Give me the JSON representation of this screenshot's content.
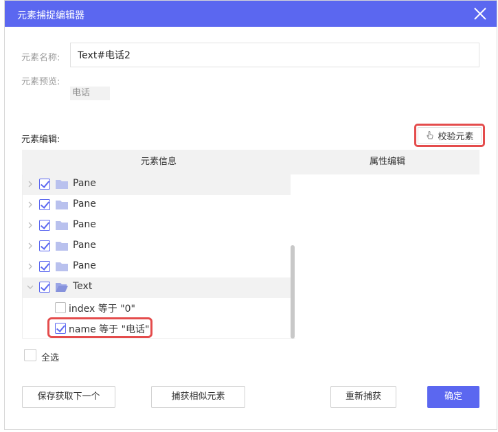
{
  "dialog": {
    "title": "元素捕捉编辑器",
    "close_icon": "close-icon"
  },
  "form": {
    "name_label": "元素名称:",
    "name_value": "Text#电话2",
    "preview_label": "元素预览:",
    "preview_value": "电话"
  },
  "editor": {
    "section_label": "元素编辑:",
    "verify_label": "校验元素",
    "verify_icon": "hand-pointer-icon",
    "col_info": "元素信息",
    "col_props": "属性编辑"
  },
  "tree": {
    "rows": [
      {
        "label": "Pane",
        "checked": true,
        "type": "folder",
        "expanded": false
      },
      {
        "label": "Pane",
        "checked": true,
        "type": "folder",
        "expanded": false
      },
      {
        "label": "Pane",
        "checked": true,
        "type": "folder",
        "expanded": false
      },
      {
        "label": "Pane",
        "checked": true,
        "type": "folder",
        "expanded": false
      },
      {
        "label": "Pane",
        "checked": true,
        "type": "folder",
        "expanded": false
      },
      {
        "label": "Text",
        "checked": true,
        "type": "folder",
        "expanded": true
      },
      {
        "label": "index 等于 \"0\"",
        "checked": false,
        "type": "attribute"
      },
      {
        "label": "name 等于 \"电话\"",
        "checked": true,
        "type": "attribute"
      }
    ]
  },
  "select_all_label": "全选",
  "buttons": {
    "save_next": "保存获取下一个",
    "capture_similar": "捕获相似元素",
    "recapture": "重新捕获",
    "confirm": "确定"
  },
  "colors": {
    "accent": "#5b67f0",
    "highlight_border": "#e44c4c"
  }
}
